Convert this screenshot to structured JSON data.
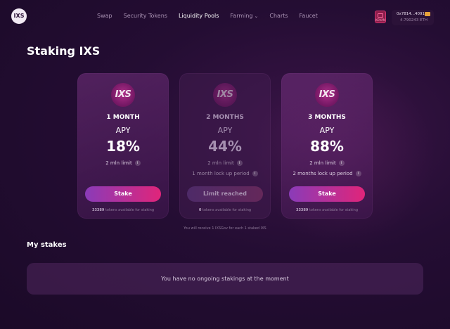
{
  "header": {
    "logo_text": "IXS",
    "nav": [
      {
        "label": "Swap",
        "active": false
      },
      {
        "label": "Security Tokens",
        "active": false
      },
      {
        "label": "Liquidity Pools",
        "active": true
      },
      {
        "label": "Farming",
        "active": false,
        "has_dropdown": true
      },
      {
        "label": "Charts",
        "active": false
      },
      {
        "label": "Faucet",
        "active": false
      }
    ],
    "network_badge": {
      "label": "KOVAN",
      "icon": "monitor-icon",
      "color": "#8c1d4a"
    },
    "wallet": {
      "address": "0x7814...4091",
      "balance": "4.790243 ETH",
      "icon": "wallet-icon"
    }
  },
  "page": {
    "title": "Staking IXS"
  },
  "cards": [
    {
      "coin": "IXS",
      "period": "1 MONTH",
      "apy_label": "APY",
      "apy": "18%",
      "limit": "2 mln limit",
      "lockup": "",
      "button": "Stake",
      "button_enabled": true,
      "available_count": "33389",
      "available_text": "tokens available for staking"
    },
    {
      "coin": "IXS",
      "period": "2 MONTHS",
      "apy_label": "APY",
      "apy": "44%",
      "limit": "2 mln limit",
      "lockup": "1 month lock up period",
      "button": "Limit reached",
      "button_enabled": false,
      "available_count": "0",
      "available_text": "tokens available for staking"
    },
    {
      "coin": "IXS",
      "period": "3 MONTHS",
      "apy_label": "APY",
      "apy": "88%",
      "limit": "2 mln limit",
      "lockup": "2 months lock up period",
      "button": "Stake",
      "button_enabled": true,
      "available_count": "33389",
      "available_text": "tokens available for staking"
    }
  ],
  "footnote": "You will receive 1 IXSGov for each 1 staked IXS",
  "my_stakes": {
    "title": "My stakes",
    "empty_message": "You have no ongoing stakings at the moment"
  },
  "colors": {
    "accent_start": "#8a3bb8",
    "accent_end": "#e0257a",
    "background": "#240d33"
  }
}
